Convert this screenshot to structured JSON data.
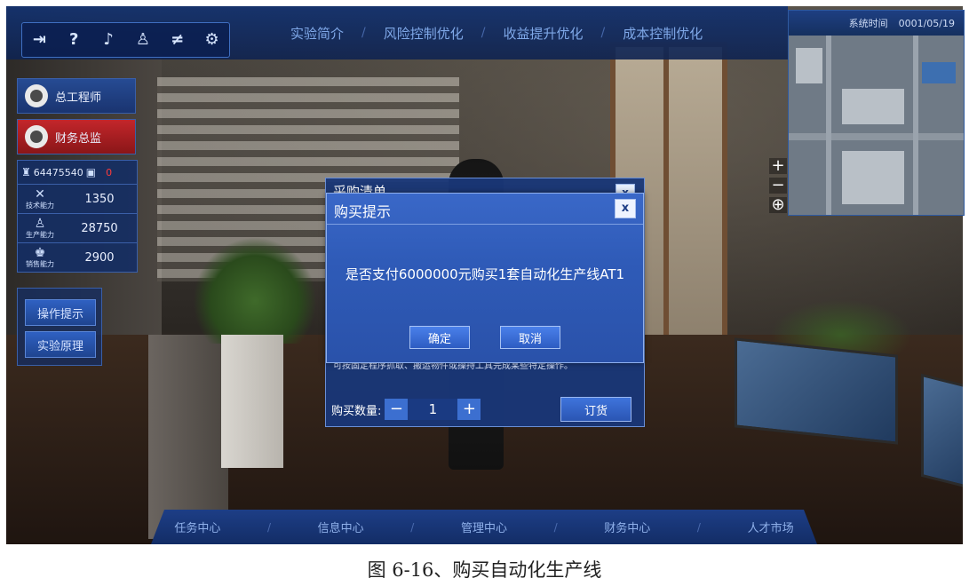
{
  "toolbar": {
    "icons": [
      "exit-icon",
      "help-icon",
      "music-icon",
      "user-icon",
      "filter-icon",
      "settings-icon"
    ],
    "icon_glyphs": [
      "⇥",
      "?",
      "♪",
      "♙",
      "≠",
      "⚙"
    ]
  },
  "top_tabs": [
    "实验简介",
    "风险控制优化",
    "收益提升优化",
    "成本控制优化"
  ],
  "minimap": {
    "time_label": "系统时间",
    "date": "0001/05/19"
  },
  "zoom": {
    "plus": "+",
    "minus": "−",
    "locate": "⊕"
  },
  "roles": [
    {
      "label": "总工程师"
    },
    {
      "label": "财务总监"
    }
  ],
  "stats": {
    "money": "64475540",
    "badge": "0",
    "rows": [
      {
        "label": "技术能力",
        "value": "1350"
      },
      {
        "label": "生产能力",
        "value": "28750"
      },
      {
        "label": "销售能力",
        "value": "2900"
      }
    ]
  },
  "aux": {
    "tips": "操作提示",
    "principle": "实验原理"
  },
  "purchase_list": {
    "title": "采购清单",
    "note": "可按固定程序抓取、搬运物件或操持工具完成某些特定操作。",
    "qty_label": "购买数量:",
    "qty": "1",
    "order": "订货"
  },
  "prompt": {
    "title": "购买提示",
    "message": "是否支付6000000元购买1套自动化生产线AT1",
    "confirm": "确定",
    "cancel": "取消",
    "close": "x"
  },
  "bottom_nav": [
    "任务中心",
    "信息中心",
    "管理中心",
    "财务中心",
    "人才市场"
  ],
  "caption": "图 6-16、购买自动化生产线"
}
